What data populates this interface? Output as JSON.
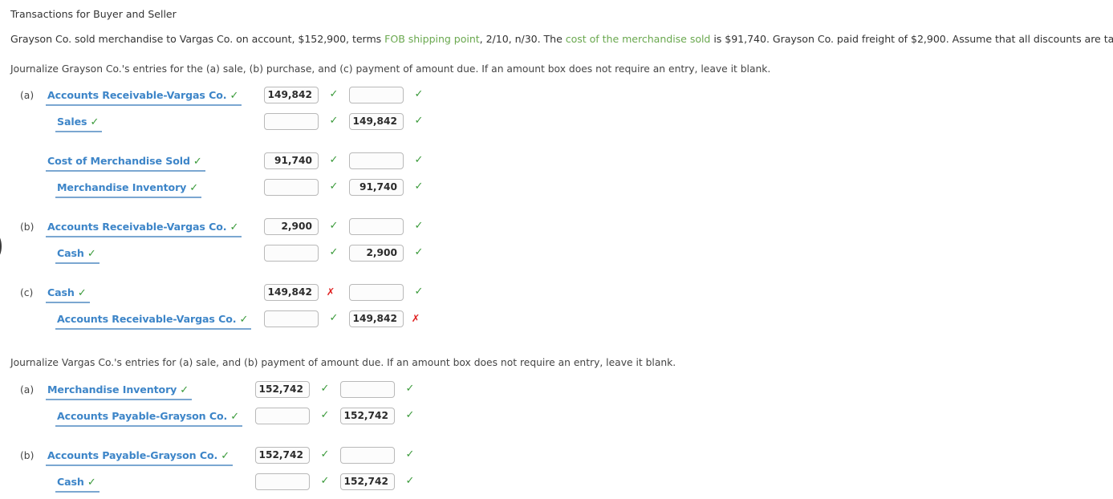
{
  "title": "Transactions for Buyer and Seller",
  "problem": {
    "part1": "Grayson Co. sold merchandise to Vargas Co. on account, $152,900, terms ",
    "hl1": "FOB shipping point",
    "part2": ", 2/10, n/30. The ",
    "hl2": "cost of the merchandise sold",
    "part3": " is $91,740. Grayson Co. paid freight of $2,900. Assume that all discounts are taken."
  },
  "instructions": {
    "grayson": "Journalize Grayson Co.'s entries for the (a) sale, (b) purchase, and (c) payment of amount due. If an amount box does not require an entry, leave it blank.",
    "vargas": "Journalize Vargas Co.'s entries for (a) sale, and (b) payment of amount due. If an amount box does not require an entry, leave it blank."
  },
  "icons": {
    "check": "✓",
    "cross": "✗"
  },
  "grayson_entries": [
    {
      "marker": "(a)",
      "lines": [
        {
          "account": "Accounts Receivable-Vargas Co.",
          "account_status": "correct",
          "indent": 0,
          "debit": "149,842",
          "debit_status": "correct",
          "credit": "",
          "credit_status": "correct"
        },
        {
          "account": "Sales",
          "account_status": "correct",
          "indent": 1,
          "debit": "",
          "debit_status": "correct",
          "credit": "149,842",
          "credit_status": "correct"
        }
      ]
    },
    {
      "marker": "",
      "lines": [
        {
          "account": "Cost of Merchandise Sold",
          "account_status": "correct",
          "indent": 0,
          "debit": "91,740",
          "debit_status": "correct",
          "credit": "",
          "credit_status": "correct"
        },
        {
          "account": "Merchandise Inventory",
          "account_status": "correct",
          "indent": 1,
          "debit": "",
          "debit_status": "correct",
          "credit": "91,740",
          "credit_status": "correct"
        }
      ]
    },
    {
      "marker": "(b)",
      "lines": [
        {
          "account": "Accounts Receivable-Vargas Co.",
          "account_status": "correct",
          "indent": 0,
          "debit": "2,900",
          "debit_status": "correct",
          "credit": "",
          "credit_status": "correct"
        },
        {
          "account": "Cash",
          "account_status": "correct",
          "indent": 1,
          "debit": "",
          "debit_status": "correct",
          "credit": "2,900",
          "credit_status": "correct"
        }
      ]
    },
    {
      "marker": "(c)",
      "lines": [
        {
          "account": "Cash",
          "account_status": "correct",
          "indent": 0,
          "debit": "149,842",
          "debit_status": "incorrect",
          "credit": "",
          "credit_status": "correct"
        },
        {
          "account": "Accounts Receivable-Vargas Co.",
          "account_status": "correct",
          "indent": 1,
          "debit": "",
          "debit_status": "correct",
          "credit": "149,842",
          "credit_status": "incorrect"
        }
      ]
    }
  ],
  "vargas_entries": [
    {
      "marker": "(a)",
      "lines": [
        {
          "account": "Merchandise Inventory",
          "account_status": "correct",
          "indent": 0,
          "debit": "152,742",
          "debit_status": "correct",
          "credit": "",
          "credit_status": "correct"
        },
        {
          "account": "Accounts Payable-Grayson Co.",
          "account_status": "correct",
          "indent": 1,
          "debit": "",
          "debit_status": "correct",
          "credit": "152,742",
          "credit_status": "correct"
        }
      ]
    },
    {
      "marker": "(b)",
      "lines": [
        {
          "account": "Accounts Payable-Grayson Co.",
          "account_status": "correct",
          "indent": 0,
          "debit": "152,742",
          "debit_status": "correct",
          "credit": "",
          "credit_status": "correct"
        },
        {
          "account": "Cash",
          "account_status": "correct",
          "indent": 1,
          "debit": "",
          "debit_status": "correct",
          "credit": "152,742",
          "credit_status": "correct"
        }
      ]
    }
  ],
  "colors": {
    "link": "#3d85c8",
    "highlight": "#6aa84f",
    "correct": "#3a9a3a",
    "incorrect": "#e02020"
  }
}
